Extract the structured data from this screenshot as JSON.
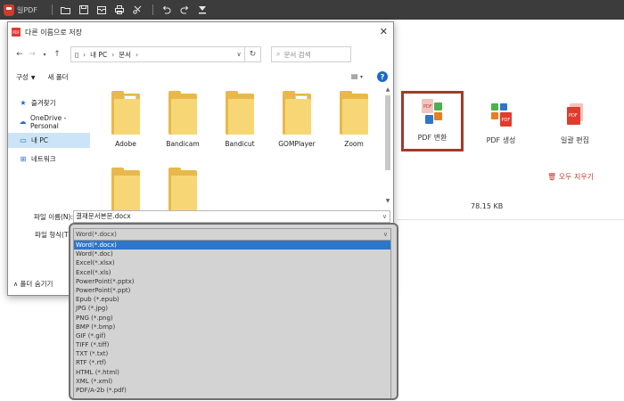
{
  "app": {
    "title": "일PDF",
    "toolbar_icons": [
      "folder-icon",
      "save-icon",
      "mail-icon",
      "print-icon",
      "scissors-icon",
      "undo-icon",
      "redo-icon",
      "download-icon"
    ]
  },
  "features": {
    "pdf_convert": "PDF 변환",
    "pdf_create": "PDF 생성",
    "batch_edit": "일괄 편집"
  },
  "clear_all": "오두 지우기",
  "file_size": "78.15 KB",
  "dialog": {
    "title": "다른 이름으로 저장",
    "address": {
      "crumbs": [
        "내 PC",
        "문서"
      ]
    },
    "search_placeholder": "문서 검색",
    "commands": {
      "organize": "구성",
      "new_folder": "새 폴더"
    },
    "nav_items": [
      {
        "label": "즐겨찾기",
        "icon": "star-icon"
      },
      {
        "label": "OneDrive - Personal",
        "icon": "cloud-icon"
      },
      {
        "label": "내 PC",
        "icon": "computer-icon"
      },
      {
        "label": "네트워크",
        "icon": "network-icon"
      }
    ],
    "folders": [
      "Adobe",
      "Bandicam",
      "Bandicut",
      "GOMPlayer",
      "Zoom",
      "",
      ""
    ],
    "filename_label": "파일 이름(N):",
    "filename_value": "결재문서본문.docx",
    "filetype_label": "파일 형식(T):",
    "hide_folders": "폴더 숨기기"
  },
  "dropdown": {
    "current": "Word(*.docx)",
    "options": [
      "Word(*.docx)",
      "Word(*.doc)",
      "Excel(*.xlsx)",
      "Excel(*.xls)",
      "PowerPoint(*.pptx)",
      "PowerPoint(*.ppt)",
      "Epub (*.epub)",
      "JPG (*.jpg)",
      "PNG (*.png)",
      "BMP (*.bmp)",
      "GIF (*.gif)",
      "TIFF (*.tiff)",
      "TXT (*.txt)",
      "RTF (*.rtf)",
      "HTML (*.html)",
      "XML (*.xml)",
      "PDF/A-2b (*.pdf)"
    ],
    "selected_index": 0
  },
  "colors": {
    "toolbar_bg": "#3c3c3c",
    "highlight": "#a33a2b",
    "selection": "#2f76c8",
    "nav_selected": "#cce4f7"
  }
}
